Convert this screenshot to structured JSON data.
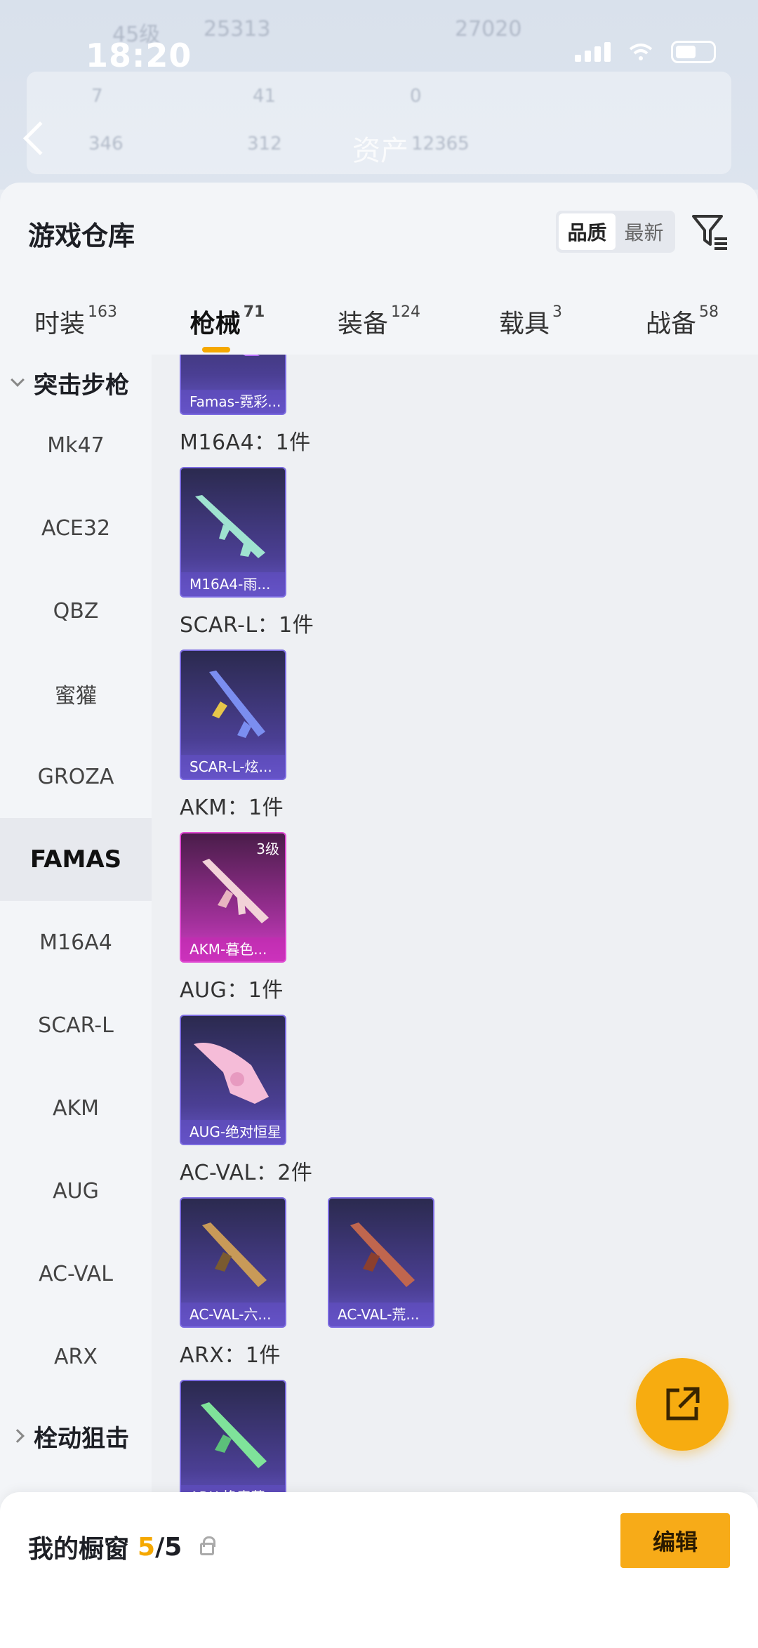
{
  "status_bar": {
    "time": "18:20"
  },
  "background_header": {
    "level_text": "45级",
    "coin_value": "25313",
    "score_value": "27020",
    "asset_label": "资产",
    "asset_value": "12365",
    "stat_values": [
      "7",
      "41",
      "0",
      "346",
      "312"
    ]
  },
  "sheet": {
    "title": "游戏仓库",
    "sort_options": [
      "品质",
      "最新"
    ],
    "active_sort": "品质"
  },
  "tabs": [
    {
      "label": "时装",
      "count": "163"
    },
    {
      "label": "枪械",
      "count": "71",
      "active": true
    },
    {
      "label": "装备",
      "count": "124"
    },
    {
      "label": "载具",
      "count": "3"
    },
    {
      "label": "战备",
      "count": "58"
    }
  ],
  "categories": {
    "group_expanded": "突击步枪",
    "items": [
      "Mk47",
      "ACE32",
      "QBZ",
      "蜜獾",
      "GROZA",
      "FAMAS",
      "M16A4",
      "SCAR-L",
      "AKM",
      "AUG",
      "AC-VAL",
      "ARX"
    ],
    "active": "FAMAS",
    "group_collapsed": "栓动狙击"
  },
  "sections": [
    {
      "title": "",
      "cards": [
        {
          "label": "Famas-霓彩...",
          "color": "purple"
        }
      ]
    },
    {
      "title": "M16A4：1件",
      "cards": [
        {
          "label": "M16A4-雨...",
          "color": "purple"
        }
      ]
    },
    {
      "title": "SCAR-L：1件",
      "cards": [
        {
          "label": "SCAR-L-炫...",
          "color": "purple"
        }
      ]
    },
    {
      "title": "AKM：1件",
      "cards": [
        {
          "label": "AKM-暮色...",
          "color": "pink",
          "level": "3级"
        }
      ]
    },
    {
      "title": "AUG：1件",
      "cards": [
        {
          "label": "AUG-绝对恒星",
          "color": "purple"
        }
      ]
    },
    {
      "title": "AC-VAL：2件",
      "cards": [
        {
          "label": "AC-VAL-六...",
          "color": "purple"
        },
        {
          "label": "AC-VAL-荒...",
          "color": "purple"
        }
      ]
    },
    {
      "title": "ARX：1件",
      "cards": [
        {
          "label": "ARX-换毒草...",
          "color": "purple"
        }
      ]
    }
  ],
  "bottom_bar": {
    "showcase_label": "我的橱窗",
    "showcase_count": "5",
    "showcase_total": "/5",
    "edit_label": "编辑"
  },
  "colors": {
    "accent": "#f7ab18",
    "card_purple": "#4b3f94",
    "card_pink": "#a3319c"
  }
}
